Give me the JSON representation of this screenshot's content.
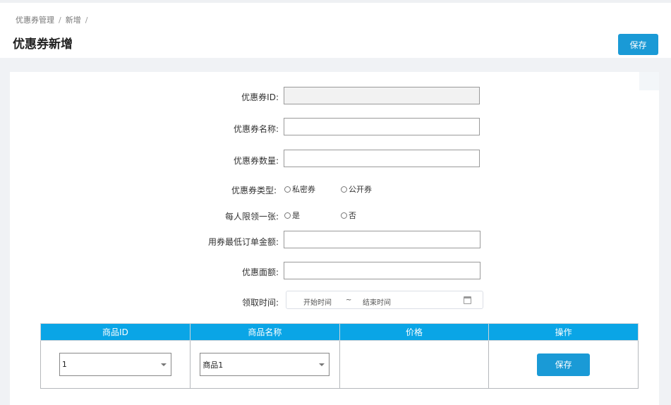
{
  "breadcrumb": {
    "item1": "优惠券管理",
    "item2": "新增",
    "sep": "/"
  },
  "header": {
    "title": "优惠券新增",
    "save_label": "保存"
  },
  "form": {
    "coupon_id_label": "优惠券ID:",
    "coupon_id_value": "",
    "coupon_name_label": "优惠券名称:",
    "coupon_name_value": "",
    "coupon_count_label": "优惠券数量:",
    "coupon_count_value": "",
    "coupon_type_label": "优惠券类型:",
    "coupon_type_options": [
      "私密券",
      "公开券"
    ],
    "per_person_label": "每人限领一张:",
    "per_person_options": [
      "是",
      "否"
    ],
    "min_order_label": "用券最低订单金额:",
    "min_order_value": "",
    "discount_label": "优惠面额:",
    "discount_value": "",
    "time_label": "领取时间:",
    "start_placeholder": "开始时间",
    "range_sep": "~",
    "end_placeholder": "结束时间"
  },
  "goods_table": {
    "columns": [
      "商品ID",
      "商品名称",
      "价格",
      "操作"
    ],
    "rows": [
      {
        "product_id": "1",
        "product_name": "商品1",
        "price": "",
        "action_label": "保存"
      }
    ]
  },
  "colors": {
    "primary": "#1a9ad6",
    "table_header": "#0aa5e6"
  }
}
